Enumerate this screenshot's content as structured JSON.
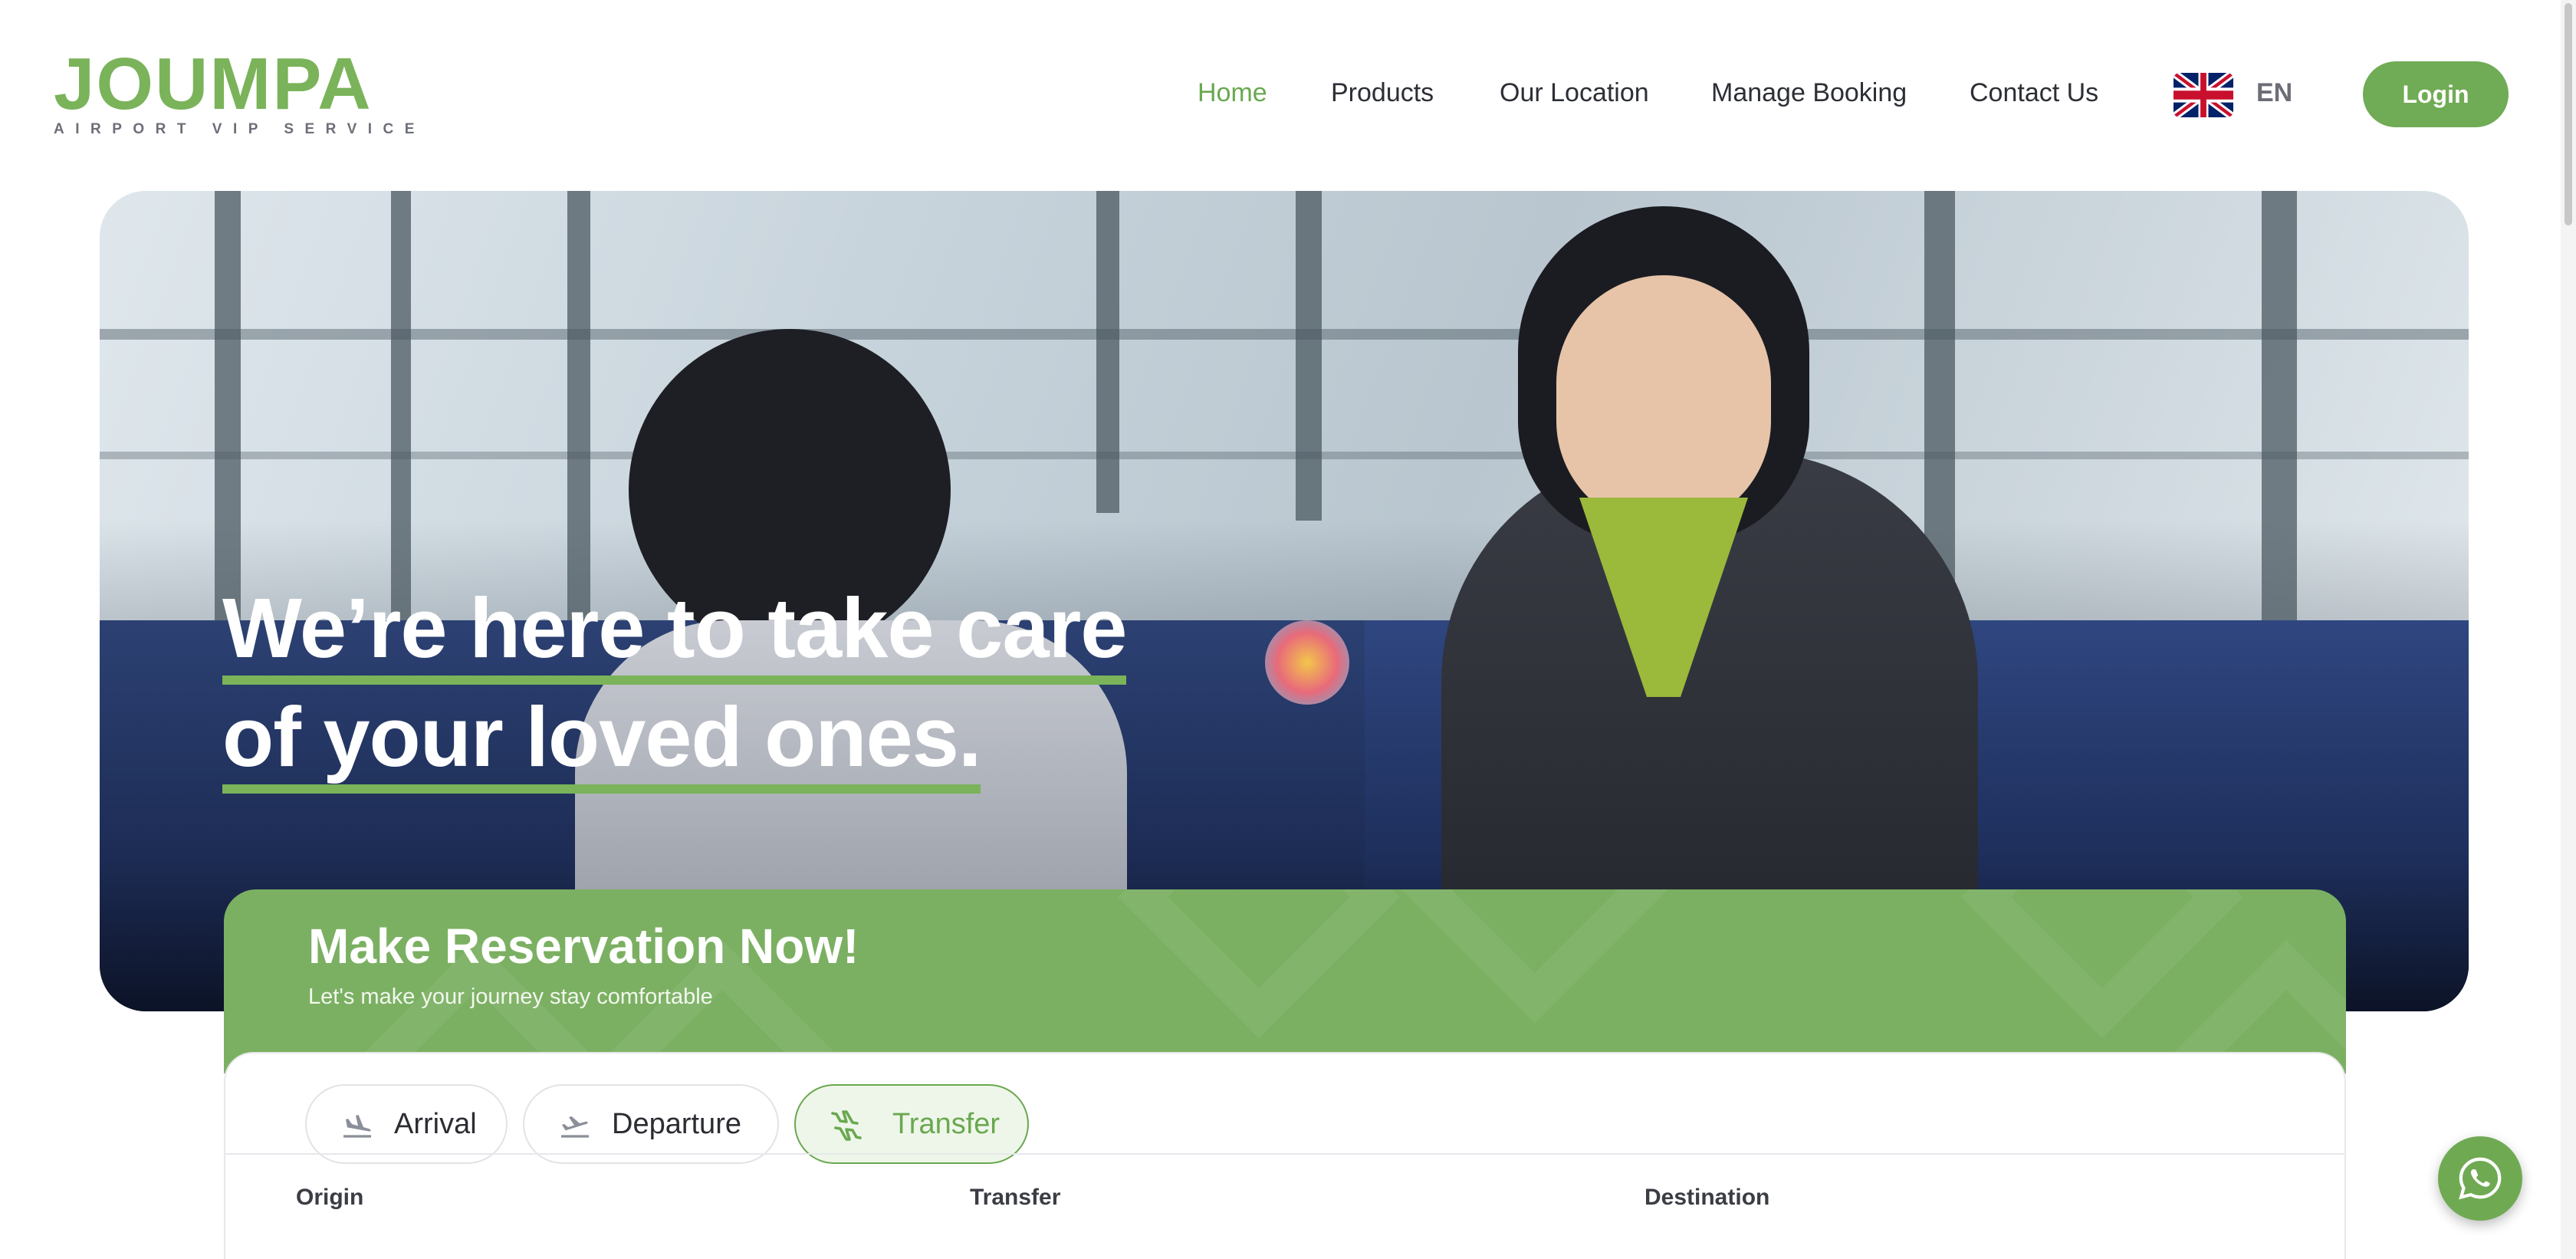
{
  "brand": {
    "name": "JOUMPA",
    "tagline": "AIRPORT VIP SERVICE",
    "color": "#7ab35a"
  },
  "nav": {
    "items": [
      {
        "label": "Home",
        "active": true
      },
      {
        "label": "Products",
        "active": false
      },
      {
        "label": "Our Location",
        "active": false
      },
      {
        "label": "Manage Booking",
        "active": false
      },
      {
        "label": "Contact Us",
        "active": false
      }
    ],
    "language_flag": "uk-flag-icon",
    "language": "EN",
    "login_label": "Login"
  },
  "hero": {
    "title_line1": "We’re here to take care",
    "title_line2": "of your loved ones."
  },
  "reservation": {
    "title": "Make Reservation Now!",
    "subtitle": "Let's make your journey stay comfortable",
    "tabs": [
      {
        "label": "Arrival",
        "icon": "arrival-plane-icon",
        "active": false
      },
      {
        "label": "Departure",
        "icon": "departure-plane-icon",
        "active": false
      },
      {
        "label": "Transfer",
        "icon": "transfer-plane-icon",
        "active": true
      }
    ],
    "fields": {
      "origin_label": "Origin",
      "transfer_label": "Transfer",
      "destination_label": "Destination"
    }
  },
  "floating": {
    "whatsapp_icon": "whatsapp-icon"
  },
  "colors": {
    "accent": "#6aa84f",
    "accent_light": "#eef6ea",
    "text_dark": "#2d2f36"
  }
}
